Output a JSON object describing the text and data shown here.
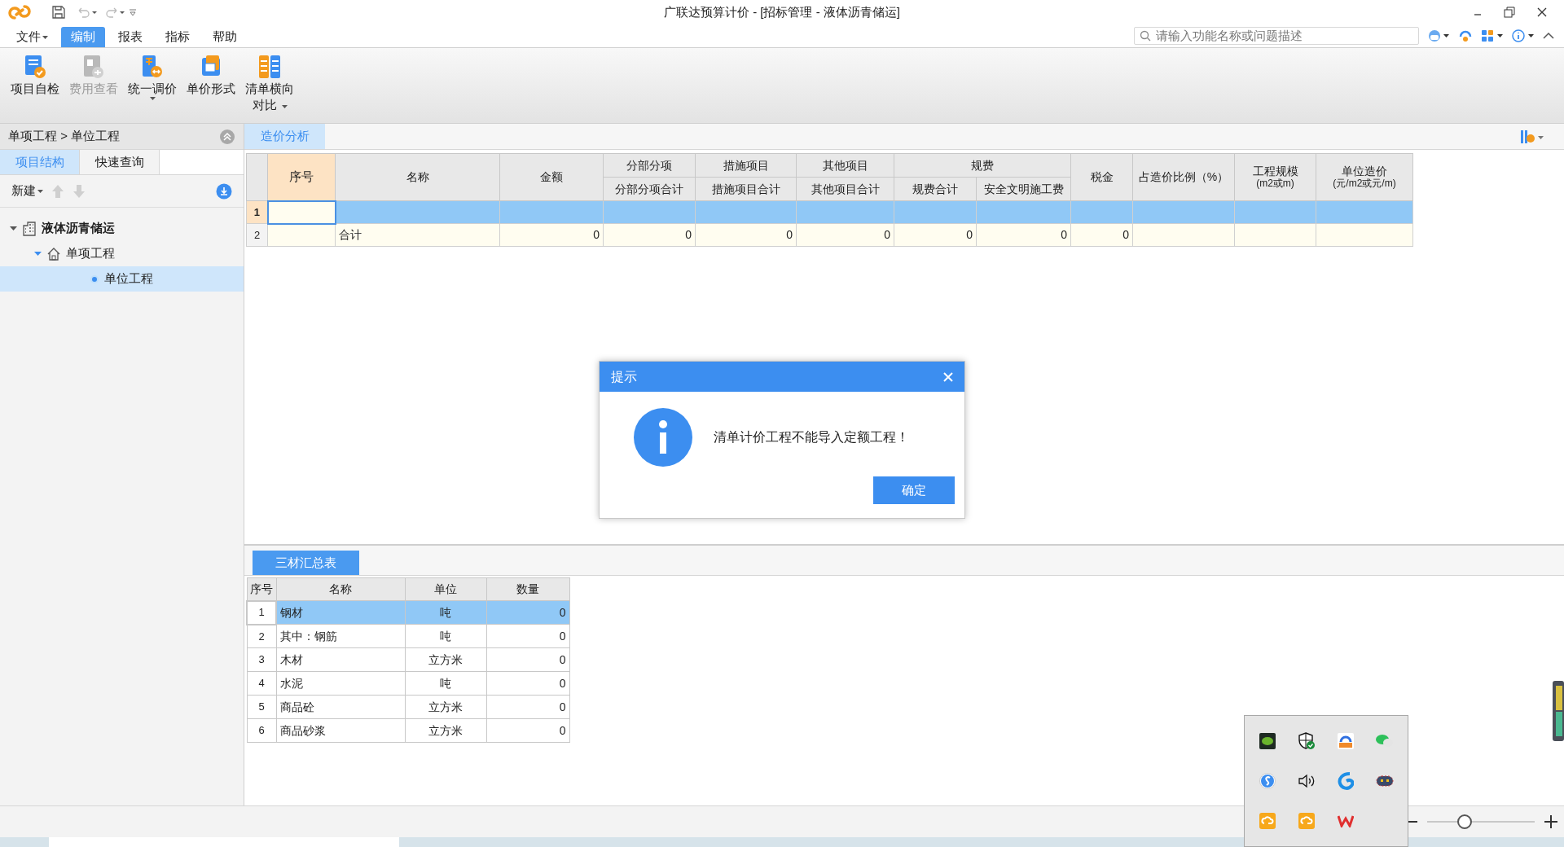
{
  "window": {
    "title": "广联达预算计价 - [招标管理 - 液体沥青储运]"
  },
  "menu": [
    {
      "label": "文件",
      "dropdown": true,
      "selected": false
    },
    {
      "label": "编制",
      "dropdown": false,
      "selected": true
    },
    {
      "label": "报表",
      "dropdown": false,
      "selected": false
    },
    {
      "label": "指标",
      "dropdown": false,
      "selected": false
    },
    {
      "label": "帮助",
      "dropdown": false,
      "selected": false
    }
  ],
  "search": {
    "placeholder": "请输入功能名称或问题描述"
  },
  "ribbon": [
    {
      "label": "项目自检",
      "kind": "check",
      "disabled": false,
      "dropdown": false
    },
    {
      "label": "费用查看",
      "kind": "view",
      "disabled": true,
      "dropdown": false
    },
    {
      "label": "统一调价",
      "kind": "price",
      "disabled": false,
      "dropdown": true
    },
    {
      "label": "单价形式",
      "kind": "form",
      "disabled": false,
      "dropdown": false
    },
    {
      "label": "清单横向对比",
      "kind": "compare",
      "disabled": false,
      "dropdown": true
    }
  ],
  "breadcrumb": "单项工程 > 单位工程",
  "left_tabs": [
    {
      "label": "项目结构",
      "selected": true
    },
    {
      "label": "快速查询",
      "selected": false
    }
  ],
  "new_button": "新建",
  "tree": [
    {
      "label": "液体沥青储运",
      "kind": "project",
      "expanded": true,
      "selected": false,
      "children": [
        {
          "label": "单项工程",
          "kind": "single",
          "expanded": true,
          "selected": false,
          "children": [
            {
              "label": "单位工程",
              "kind": "unit",
              "selected": true
            }
          ]
        }
      ]
    }
  ],
  "main_tabs": [
    {
      "label": "造价分析",
      "selected": true
    }
  ],
  "table": {
    "columns": [
      {
        "label": "序号",
        "selected": true
      },
      {
        "label": "名称",
        "selected": false
      },
      {
        "label": "金额",
        "selected": false
      },
      {
        "group": "分部分项",
        "children": [
          "分部分项合计"
        ],
        "selected": false
      },
      {
        "group": "措施项目",
        "children": [
          "措施项目合计"
        ],
        "selected": false
      },
      {
        "group": "其他项目",
        "children": [
          "其他项目合计"
        ],
        "selected": false
      },
      {
        "group": "规费",
        "children": [
          "规费合计",
          "安全文明施工费"
        ],
        "selected": false
      },
      {
        "label": "税金",
        "selected": false
      },
      {
        "label": "占造价比例（%）",
        "selected": false
      },
      {
        "label": "工程规模",
        "sublabel": "(m2或m)",
        "selected": false
      },
      {
        "label": "单位造价",
        "sublabel": "(元/m2或元/m)",
        "selected": false
      }
    ],
    "rows": [
      {
        "number": "1",
        "selected": true
      },
      {
        "number": "2",
        "selected": false,
        "cells": [
          null,
          "合计",
          "0",
          "0",
          "0",
          "0",
          "0",
          "0",
          "0",
          null,
          null,
          null
        ]
      }
    ]
  },
  "bottom_tabs": [
    {
      "label": "三材汇总表",
      "selected": true
    }
  ],
  "materials": {
    "columns": [
      "序号",
      "名称",
      "单位",
      "数量"
    ],
    "rows": [
      {
        "number": "1",
        "name": "钢材",
        "unit": "吨",
        "quantity": "0",
        "selected": true
      },
      {
        "number": "2",
        "name": "其中：钢筋",
        "unit": "吨",
        "quantity": "0",
        "selected": false
      },
      {
        "number": "3",
        "name": "木材",
        "unit": "立方米",
        "quantity": "0",
        "selected": false
      },
      {
        "number": "4",
        "name": "水泥",
        "unit": "吨",
        "quantity": "0",
        "selected": false
      },
      {
        "number": "5",
        "name": "商品砼",
        "unit": "立方米",
        "quantity": "0",
        "selected": false
      },
      {
        "number": "6",
        "name": "商品砂浆",
        "unit": "立方米",
        "quantity": "0",
        "selected": false
      }
    ]
  },
  "dialog": {
    "title": "提示",
    "message": "清单计价工程不能导入定额工程！",
    "button": "确定"
  },
  "zoom": {
    "level": 0.35
  }
}
